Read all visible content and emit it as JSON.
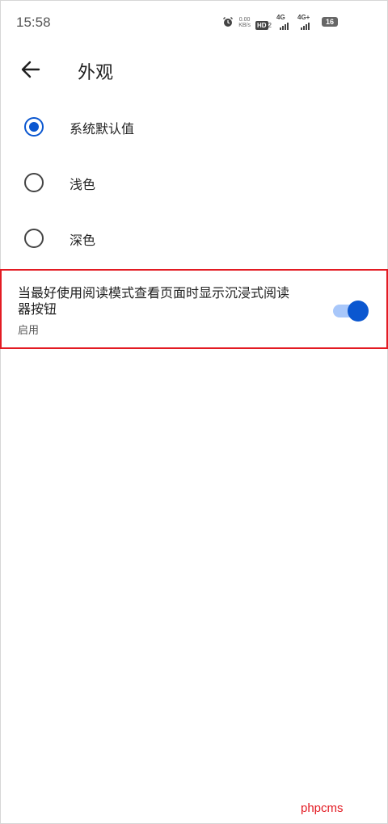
{
  "status_bar": {
    "time": "15:58",
    "net_speed_value": "0.00",
    "net_speed_unit": "KB/s",
    "hd_label": "HD",
    "hd_index": "2",
    "signal1_label": "4G",
    "signal2_label": "4G+",
    "battery_level": "16"
  },
  "app_bar": {
    "title": "外观",
    "back_icon": "arrow-left-icon"
  },
  "theme_options": [
    {
      "label": "系统默认值",
      "selected": true
    },
    {
      "label": "浅色",
      "selected": false
    },
    {
      "label": "深色",
      "selected": false
    }
  ],
  "reader_setting": {
    "title": "当最好使用阅读模式查看页面时显示沉浸式阅读器按钮",
    "subtitle": "启用",
    "enabled": true
  },
  "watermark": "phpcms",
  "colors": {
    "accent": "#0b57d0",
    "track": "#a8c7fa",
    "highlight_border": "#e31b23"
  }
}
